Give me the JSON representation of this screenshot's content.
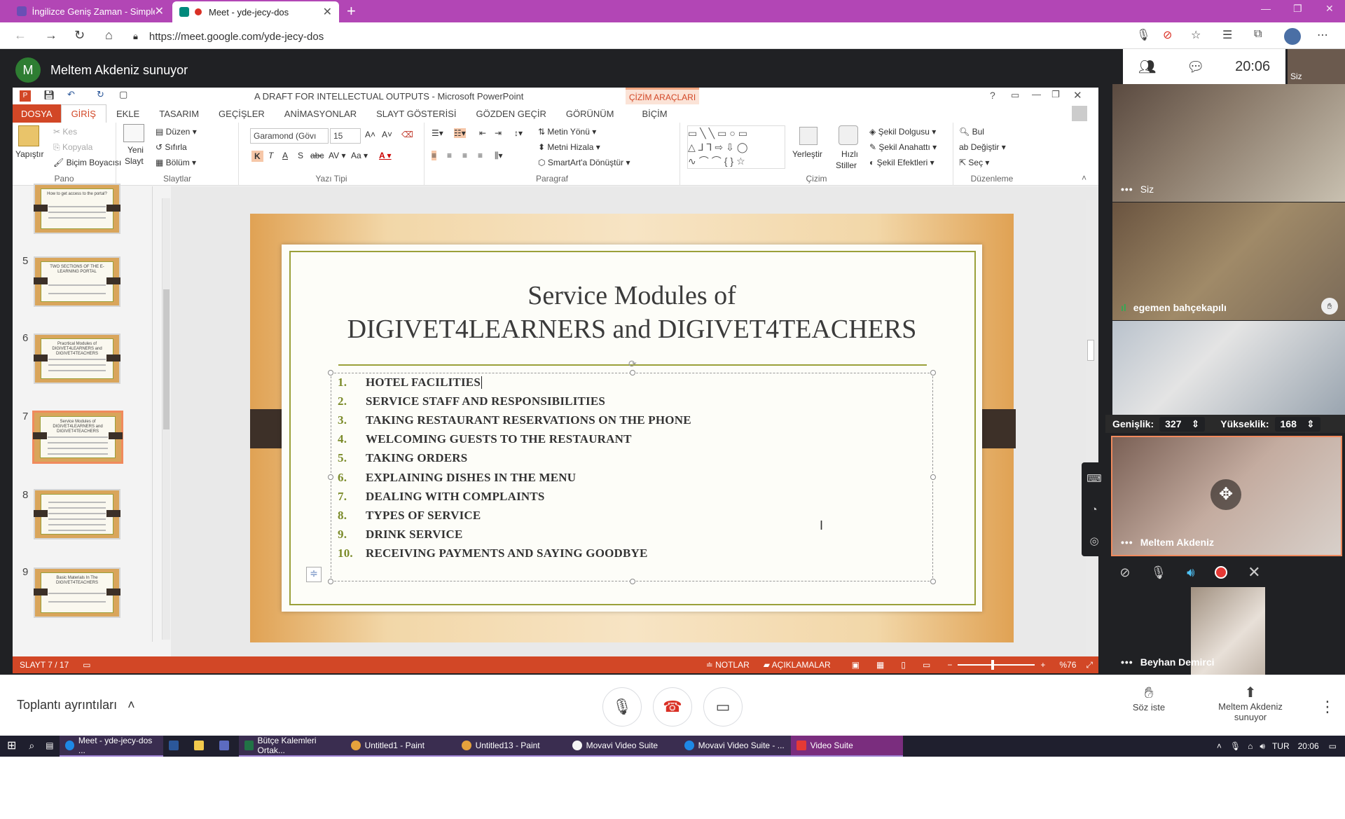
{
  "browser": {
    "tabs": [
      {
        "title": "İngilizce Geniş Zaman - Simple P",
        "active": false
      },
      {
        "title": "Meet - yde-jecy-dos",
        "active": true
      }
    ],
    "url": "https://meet.google.com/yde-jecy-dos"
  },
  "meet": {
    "presenter_initial": "M",
    "presenter_label": "Meltem Akdeniz sunuyor",
    "time": "20:06",
    "self_mini_label": "Siz",
    "participants": [
      {
        "name": "Siz"
      },
      {
        "name": "egemen bahçekapılı"
      },
      {
        "name": ""
      },
      {
        "name": "Meltem Akdeniz"
      },
      {
        "name": "Beyhan Demirci"
      }
    ],
    "size_bar": {
      "width_label": "Genişlik:",
      "width_value": "327",
      "height_label": "Yükseklik:",
      "height_value": "168"
    },
    "details_label": "Toplantı ayrıntıları",
    "raise_hand_label": "Söz iste",
    "presenting_label_line1": "Meltem Akdeniz",
    "presenting_label_line2": "sunuyor"
  },
  "ppt": {
    "window_title": "A DRAFT FOR INTELLECTUAL OUTPUTS - Microsoft PowerPoint",
    "contextual_tab": "ÇİZİM ARAÇLARI",
    "menu": [
      "DOSYA",
      "GİRİŞ",
      "EKLE",
      "TASARIM",
      "GEÇİŞLER",
      "ANİMASYONLAR",
      "SLAYT GÖSTERİSİ",
      "GÖZDEN GEÇİR",
      "GÖRÜNÜM",
      "BİÇİM"
    ],
    "ribbon": {
      "pano": {
        "label": "Pano",
        "paste": "Yapıştır",
        "cut": "Kes",
        "copy": "Kopyala",
        "format_painter": "Biçim Boyacısı"
      },
      "slaytlar": {
        "label": "Slaytlar",
        "new_slide_1": "Yeni",
        "new_slide_2": "Slayt",
        "layout": "Düzen",
        "reset": "Sıfırla",
        "section": "Bölüm"
      },
      "yazi_tipi": {
        "label": "Yazı Tipi",
        "font": "Garamond (Gövı",
        "size": "15"
      },
      "paragraf": {
        "label": "Paragraf",
        "text_direction": "Metin Yönü",
        "align_text": "Metni Hizala",
        "smartart": "SmartArt'a Dönüştür"
      },
      "cizim": {
        "label": "Çizim",
        "arrange": "Yerleştir",
        "quick_styles_1": "Hızlı",
        "quick_styles_2": "Stiller",
        "shape_fill": "Şekil Dolgusu",
        "shape_outline": "Şekil Anahattı",
        "shape_effects": "Şekil Efektleri"
      },
      "duzenleme": {
        "label": "Düzenleme",
        "find": "Bul",
        "replace": "Değiştir",
        "select": "Seç"
      }
    },
    "thumbnails": [
      {
        "num": "",
        "title": "How to get access to the portal?"
      },
      {
        "num": "5",
        "title": "TWO SECTIONS OF THE E-LEARNING PORTAL"
      },
      {
        "num": "6",
        "title": "Pracrtical Modules of DIGIVET4LEARNERS and DIGIVET4TEACHERS"
      },
      {
        "num": "7",
        "title": "Service Modules of DIGIVET4LEARNERS and DIGIVET4TEACHERS"
      },
      {
        "num": "8",
        "title": ""
      },
      {
        "num": "9",
        "title": "Basic Materials In The DIGIVET4TEACHERS"
      }
    ],
    "slide": {
      "title_line1": "Service Modules of",
      "title_line2": "DIGIVET4LEARNERS and DIGIVET4TEACHERS",
      "items": [
        "HOTEL FACILITIES",
        "SERVICE STAFF AND RESPONSIBILITIES",
        "TAKING RESTAURANT RESERVATIONS ON THE PHONE",
        "WELCOMING GUESTS TO THE RESTAURANT",
        "TAKING ORDERS",
        "EXPLAINING DISHES IN THE MENU",
        "DEALING WITH COMPLAINTS",
        "TYPES OF SERVICE",
        "DRINK SERVICE",
        "RECEIVING PAYMENTS AND SAYING GOODBYE"
      ]
    },
    "status": {
      "slide_counter": "SLAYT 7 / 17",
      "notes": "NOTLAR",
      "comments": "AÇIKLAMALAR",
      "zoom": "%76"
    }
  },
  "taskbar": {
    "items": [
      {
        "label": "Meet - yde-jecy-dos ...",
        "color": "#1e88e5"
      },
      {
        "label": "",
        "color": "#2b579a"
      },
      {
        "label": "",
        "color": "#f2c94c"
      },
      {
        "label": "",
        "color": "#5c6bc0"
      },
      {
        "label": "Bütçe Kalemleri Ortak...",
        "color": "#217346"
      },
      {
        "label": "Untitled1 - Paint",
        "color": "#e6a23c"
      },
      {
        "label": "Untitled13 - Paint",
        "color": "#e6a23c"
      },
      {
        "label": "Movavi Video Suite",
        "color": "#f5f5f5"
      },
      {
        "label": "Movavi Video Suite - ...",
        "color": "#1e88e5"
      },
      {
        "label": "Video Suite",
        "color": "#e53935"
      }
    ],
    "lang": "TUR",
    "clock": "20:06"
  }
}
